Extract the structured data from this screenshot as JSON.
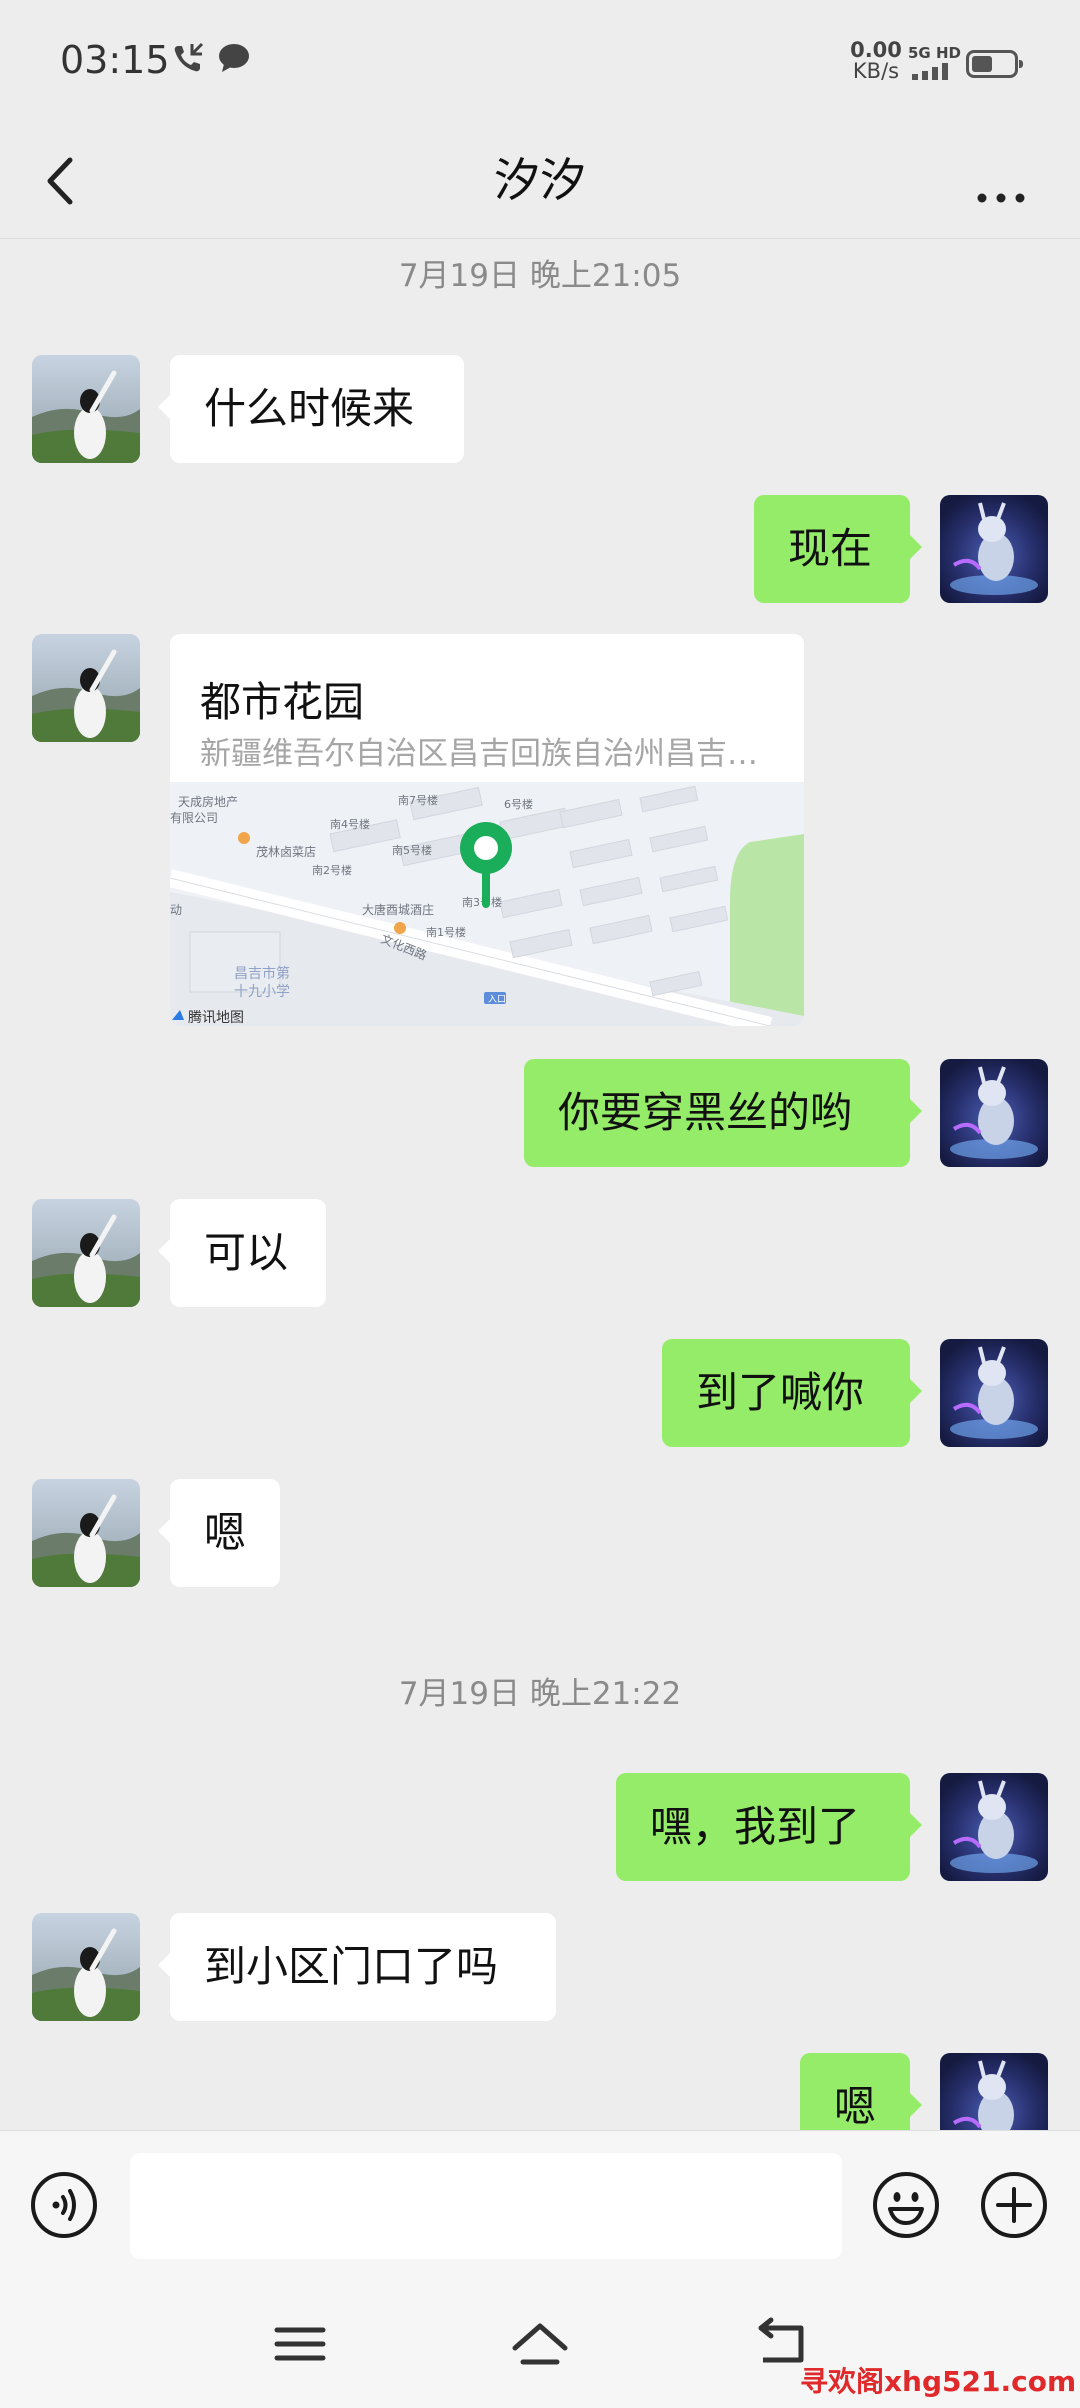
{
  "status_bar": {
    "time": "03:15",
    "rate_value": "0.00",
    "rate_unit": "KB/s",
    "network": "5G HD",
    "icons": [
      "call-icon",
      "message-icon",
      "signal-icon",
      "battery-icon"
    ]
  },
  "nav": {
    "title": "汐汐",
    "icons": [
      "back-arrow-icon",
      "more-icon"
    ]
  },
  "messages": {
    "timestamp_1": "7月19日 晚上21:05",
    "m1": "什么时候来",
    "m2": "现在",
    "location": {
      "name": "都市花园",
      "address": "新疆维吾尔自治区昌吉回族自治州昌吉…",
      "map_labels": {
        "l1": "天成房地产",
        "l2": "有限公司",
        "l3": "茂林卤菜店",
        "l4": "南7号楼",
        "l5": "南4号楼",
        "l6": "南5号楼",
        "l7": "南2号楼",
        "l8": "大唐酉城酒庄",
        "l9": "南1号楼",
        "l10": "南3号楼",
        "l11": "文化西路",
        "l12": "昌吉市第",
        "l13": "十九小学",
        "l14": "入口",
        "l15": "腾讯地图",
        "l16": "动",
        "l17": "6号楼"
      }
    },
    "m3": "你要穿黑丝的哟",
    "m4": "可以",
    "m5": "到了喊你",
    "m6": "嗯",
    "timestamp_2": "7月19日 晚上21:22",
    "m7": "嘿，我到了",
    "m8": "到小区门口了吗",
    "m9": "嗯"
  },
  "input_bar": {
    "text": "",
    "icons": [
      "voice-icon",
      "emoji-icon",
      "plus-icon"
    ]
  },
  "system_nav": {
    "icons": [
      "menu-icon",
      "home-icon",
      "back-icon"
    ]
  },
  "watermark": "寻欢阁xhg521.com",
  "colors": {
    "background": "#ededed",
    "outgoing_bubble": "#95ec69",
    "incoming_bubble": "#ffffff",
    "map_pin": "#1aad5a",
    "watermark": "#e0292a"
  }
}
